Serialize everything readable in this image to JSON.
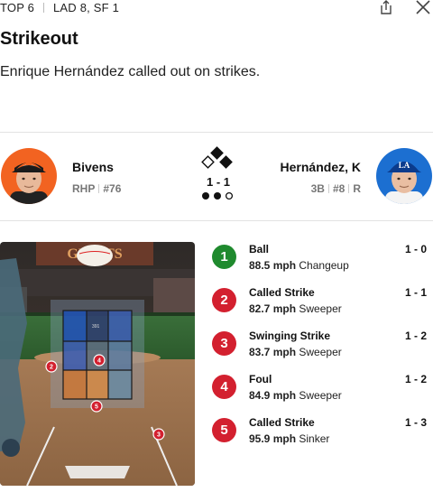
{
  "header": {
    "inning": "TOP 6",
    "score": "LAD 8, SF 1"
  },
  "play": {
    "title": "Strikeout",
    "description": "Enrique Hernández called out on strikes."
  },
  "matchup": {
    "pitcher": {
      "name": "Bivens",
      "position": "RHP",
      "number": "#76",
      "team_color": "#f26321"
    },
    "batter": {
      "name": "Hernández, K",
      "position": "3B",
      "number": "#8",
      "bats": "R",
      "team_color": "#1c6fd1"
    },
    "count": "1 - 1",
    "bases": {
      "first": false,
      "second": true,
      "third": false
    },
    "outs": 2
  },
  "strike_zone": {
    "jumbotron_text": "391"
  },
  "pitches": [
    {
      "num": "1",
      "result": "Ball",
      "speed": "88.5 mph",
      "type": "Changeup",
      "count": "1 - 0",
      "color": "#1f8a2e"
    },
    {
      "num": "2",
      "result": "Called Strike",
      "speed": "82.7 mph",
      "type": "Sweeper",
      "count": "1 - 1",
      "color": "#d3202f"
    },
    {
      "num": "3",
      "result": "Swinging Strike",
      "speed": "83.7 mph",
      "type": "Sweeper",
      "count": "1 - 2",
      "color": "#d3202f"
    },
    {
      "num": "4",
      "result": "Foul",
      "speed": "84.9 mph",
      "type": "Sweeper",
      "count": "1 - 2",
      "color": "#d3202f"
    },
    {
      "num": "5",
      "result": "Called Strike",
      "speed": "95.9 mph",
      "type": "Sinker",
      "count": "1 - 3",
      "color": "#d3202f"
    }
  ]
}
